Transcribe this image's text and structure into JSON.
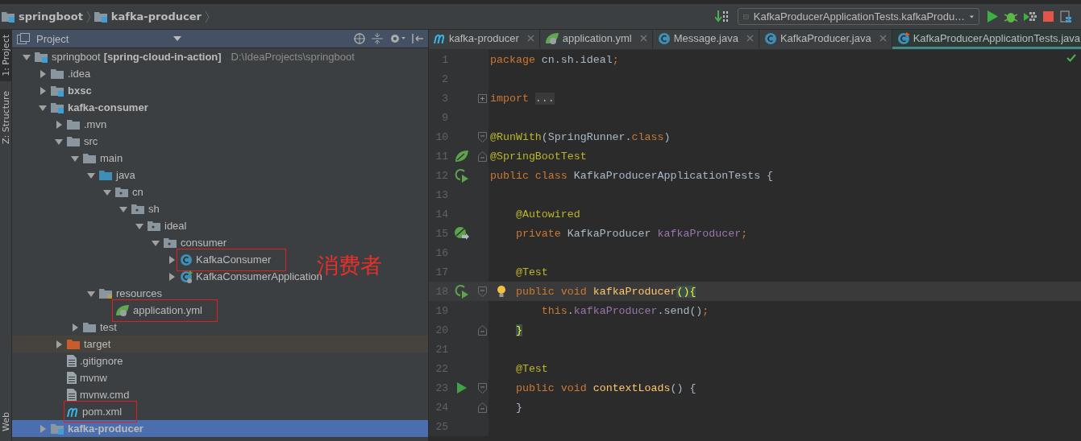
{
  "breadcrumbs": [
    {
      "label": "springboot"
    },
    {
      "label": "kafka-producer"
    }
  ],
  "run_config": {
    "label": "KafkaProducerApplicationTests.kafkaProdu…"
  },
  "side_tabs": [
    {
      "label": "1: Project",
      "selected": true
    },
    {
      "label": "Z: Structure",
      "selected": false
    },
    {
      "label": "Web",
      "selected": false
    }
  ],
  "project_panel": {
    "title": "Project",
    "annotation": "消费者",
    "tree": [
      {
        "label": "springboot",
        "module": "[spring-cloud-in-action]",
        "path": "D:\\IdeaProjects\\springboot",
        "kind": "root",
        "expanded": true,
        "selected": false,
        "boxed": false,
        "children": [
          {
            "label": ".idea",
            "kind": "folder",
            "expanded": false,
            "selected": false,
            "boxed": false
          },
          {
            "label": "bxsc",
            "kind": "module",
            "expanded": false,
            "selected": false,
            "boxed": false
          },
          {
            "label": "kafka-consumer",
            "kind": "module",
            "expanded": true,
            "selected": false,
            "boxed": false,
            "children": [
              {
                "label": ".mvn",
                "kind": "folder",
                "expanded": false,
                "selected": false,
                "boxed": false
              },
              {
                "label": "src",
                "kind": "folder",
                "expanded": true,
                "selected": false,
                "boxed": false,
                "children": [
                  {
                    "label": "main",
                    "kind": "folder",
                    "expanded": true,
                    "selected": false,
                    "boxed": false,
                    "children": [
                      {
                        "label": "java",
                        "kind": "source",
                        "expanded": true,
                        "selected": false,
                        "boxed": false,
                        "children": [
                          {
                            "label": "cn",
                            "kind": "package",
                            "expanded": true,
                            "selected": false,
                            "boxed": false,
                            "children": [
                              {
                                "label": "sh",
                                "kind": "package",
                                "expanded": true,
                                "selected": false,
                                "boxed": false,
                                "children": [
                                  {
                                    "label": "ideal",
                                    "kind": "package",
                                    "expanded": true,
                                    "selected": false,
                                    "boxed": false,
                                    "children": [
                                      {
                                        "label": "consumer",
                                        "kind": "package",
                                        "expanded": true,
                                        "selected": false,
                                        "boxed": false,
                                        "children": [
                                          {
                                            "label": "KafkaConsumer",
                                            "kind": "class",
                                            "expanded": false,
                                            "selected": false,
                                            "boxed": true
                                          },
                                          {
                                            "label": "KafkaConsumerApplication",
                                            "kind": "spring-class",
                                            "expanded": false,
                                            "selected": false,
                                            "boxed": false
                                          }
                                        ]
                                      }
                                    ]
                                  }
                                ]
                              }
                            ]
                          }
                        ]
                      },
                      {
                        "label": "resources",
                        "kind": "resources",
                        "expanded": true,
                        "selected": false,
                        "boxed": false,
                        "children": [
                          {
                            "label": "application.yml",
                            "kind": "spring-file",
                            "selected": false,
                            "boxed": true
                          }
                        ]
                      }
                    ]
                  },
                  {
                    "label": "test",
                    "kind": "folder",
                    "expanded": false,
                    "selected": false,
                    "boxed": false
                  }
                ]
              },
              {
                "label": "target",
                "kind": "excluded",
                "expanded": false,
                "selected": false,
                "boxed": false
              },
              {
                "label": ".gitignore",
                "kind": "file",
                "selected": false,
                "boxed": false
              },
              {
                "label": "mvnw",
                "kind": "file",
                "selected": false,
                "boxed": false
              },
              {
                "label": "mvnw.cmd",
                "kind": "file",
                "selected": false,
                "boxed": false
              },
              {
                "label": "pom.xml",
                "kind": "maven",
                "selected": false,
                "boxed": true
              }
            ]
          },
          {
            "label": "kafka-producer",
            "kind": "module",
            "expanded": false,
            "selected": true,
            "boxed": false
          }
        ]
      }
    ]
  },
  "editor": {
    "tabs": [
      {
        "label": "kafka-producer",
        "kind": "maven",
        "selected": false
      },
      {
        "label": "application.yml",
        "kind": "spring-file",
        "selected": false
      },
      {
        "label": "Message.java",
        "kind": "class",
        "selected": false
      },
      {
        "label": "KafkaProducer.java",
        "kind": "class",
        "selected": false
      },
      {
        "label": "KafkaProducerApplicationTests.java",
        "kind": "test-class",
        "selected": true
      }
    ],
    "lines": [
      {
        "number": "1",
        "current": false,
        "tokens": [
          {
            "t": "package",
            "kind": "keyword"
          },
          {
            "t": " cn.sh.ideal",
            "kind": "plain"
          },
          {
            "t": ";",
            "kind": "keyword"
          }
        ]
      },
      {
        "number": "2",
        "current": false
      },
      {
        "number": "3",
        "current": false,
        "markers": [
          {
            "kind": "fold-plus"
          }
        ],
        "tokens": [
          {
            "t": "import ",
            "kind": "keyword"
          },
          {
            "t": "...",
            "kind": "folded"
          }
        ]
      },
      {
        "number": "9",
        "current": false
      },
      {
        "number": "10",
        "current": false,
        "markers": [
          {
            "kind": "fold-start"
          }
        ],
        "tokens": [
          {
            "t": "@RunWith",
            "kind": "annotation"
          },
          {
            "t": "(SpringRunner.",
            "kind": "plain"
          },
          {
            "t": "class",
            "kind": "keyword"
          },
          {
            "t": ")",
            "kind": "plain"
          }
        ]
      },
      {
        "number": "11",
        "current": false,
        "markers": [
          {
            "kind": "spring"
          },
          {
            "kind": "fold-end"
          }
        ],
        "tokens": [
          {
            "t": "@SpringBootTest",
            "kind": "annotation"
          }
        ]
      },
      {
        "number": "12",
        "current": false,
        "markers": [
          {
            "kind": "run"
          }
        ],
        "tokens": [
          {
            "t": "public class ",
            "kind": "keyword"
          },
          {
            "t": "KafkaProducerApplicationTests {",
            "kind": "plain"
          }
        ]
      },
      {
        "number": "13",
        "current": false
      },
      {
        "number": "14",
        "current": false,
        "tokens": [
          {
            "t": "    @Autowired",
            "kind": "annotation"
          }
        ]
      },
      {
        "number": "15",
        "current": false,
        "markers": [
          {
            "kind": "bean"
          }
        ],
        "tokens": [
          {
            "t": "    private ",
            "kind": "keyword"
          },
          {
            "t": "KafkaProducer ",
            "kind": "plain"
          },
          {
            "t": "kafkaProducer",
            "kind": "field"
          },
          {
            "t": ";",
            "kind": "keyword"
          }
        ]
      },
      {
        "number": "16",
        "current": false
      },
      {
        "number": "17",
        "current": false,
        "tokens": [
          {
            "t": "    @Test",
            "kind": "annotation"
          }
        ]
      },
      {
        "number": "18",
        "current": true,
        "markers": [
          {
            "kind": "run"
          },
          {
            "kind": "fold-start"
          },
          {
            "kind": "bulb"
          }
        ],
        "tokens": [
          {
            "t": "    public void ",
            "kind": "keyword"
          },
          {
            "t": "kafkaProducer",
            "kind": "method"
          },
          {
            "t": "(){",
            "kind": "match"
          }
        ]
      },
      {
        "number": "19",
        "current": false,
        "tokens": [
          {
            "t": "        this",
            "kind": "keyword"
          },
          {
            "t": ".",
            "kind": "plain"
          },
          {
            "t": "kafkaProducer",
            "kind": "field"
          },
          {
            "t": ".send()",
            "kind": "plain"
          },
          {
            "t": ";",
            "kind": "keyword"
          }
        ]
      },
      {
        "number": "20",
        "current": false,
        "markers": [
          {
            "kind": "fold-end"
          }
        ],
        "tokens": [
          {
            "t": "    }",
            "kind": "match"
          }
        ]
      },
      {
        "number": "21",
        "current": false
      },
      {
        "number": "22",
        "current": false,
        "tokens": [
          {
            "t": "    @Test",
            "kind": "annotation"
          }
        ]
      },
      {
        "number": "23",
        "current": false,
        "markers": [
          {
            "kind": "play"
          },
          {
            "kind": "fold-start"
          }
        ],
        "tokens": [
          {
            "t": "    public void ",
            "kind": "keyword"
          },
          {
            "t": "contextLoads",
            "kind": "method"
          },
          {
            "t": "() {",
            "kind": "plain"
          }
        ]
      },
      {
        "number": "24",
        "current": false,
        "markers": [
          {
            "kind": "fold-end"
          }
        ],
        "tokens": [
          {
            "t": "    }",
            "kind": "plain"
          }
        ]
      },
      {
        "number": "25",
        "current": false
      }
    ]
  }
}
